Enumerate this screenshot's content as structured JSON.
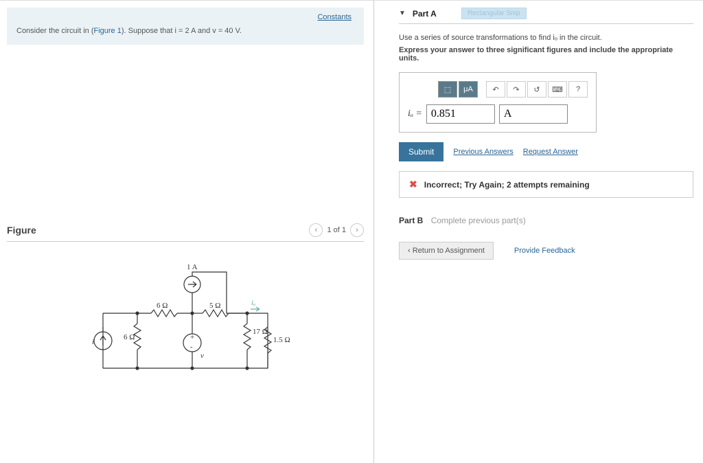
{
  "left": {
    "constants": "Constants",
    "problem_prefix": "Consider the circuit in (",
    "figure_link": "Figure 1",
    "problem_suffix": "). Suppose that i = 2 A and v = 40 V.",
    "figure_title": "Figure",
    "page_indicator": "1 of 1",
    "circuit": {
      "i_src": "i",
      "r1": "6 Ω",
      "r2": "6 Ω",
      "r3": "5 Ω",
      "r4": "17 Ω",
      "r5": "1.5 Ω",
      "v_src": "v",
      "i_top": "1 A",
      "io": "iₒ"
    }
  },
  "right": {
    "part_a_title": "Part A",
    "snip": "Rectangular Snip",
    "instr1": "Use a series of source transformations to find iₒ in the circuit.",
    "instr2": "Express your answer to three significant figures and include the appropriate units.",
    "toolbar": {
      "templates": "⬚",
      "units": "μA",
      "undo": "↶",
      "redo": "↷",
      "reset": "↺",
      "keyboard": "⌨",
      "help": "?"
    },
    "var_label": "iₒ = ",
    "value": "0.851",
    "unit": "A",
    "submit": "Submit",
    "prev_answers": "Previous Answers",
    "request_answer": "Request Answer",
    "feedback": "Incorrect; Try Again; 2 attempts remaining",
    "part_b_title": "Part B",
    "part_b_msg": "Complete previous part(s)",
    "return": "Return to Assignment",
    "provide_feedback": "Provide Feedback"
  }
}
